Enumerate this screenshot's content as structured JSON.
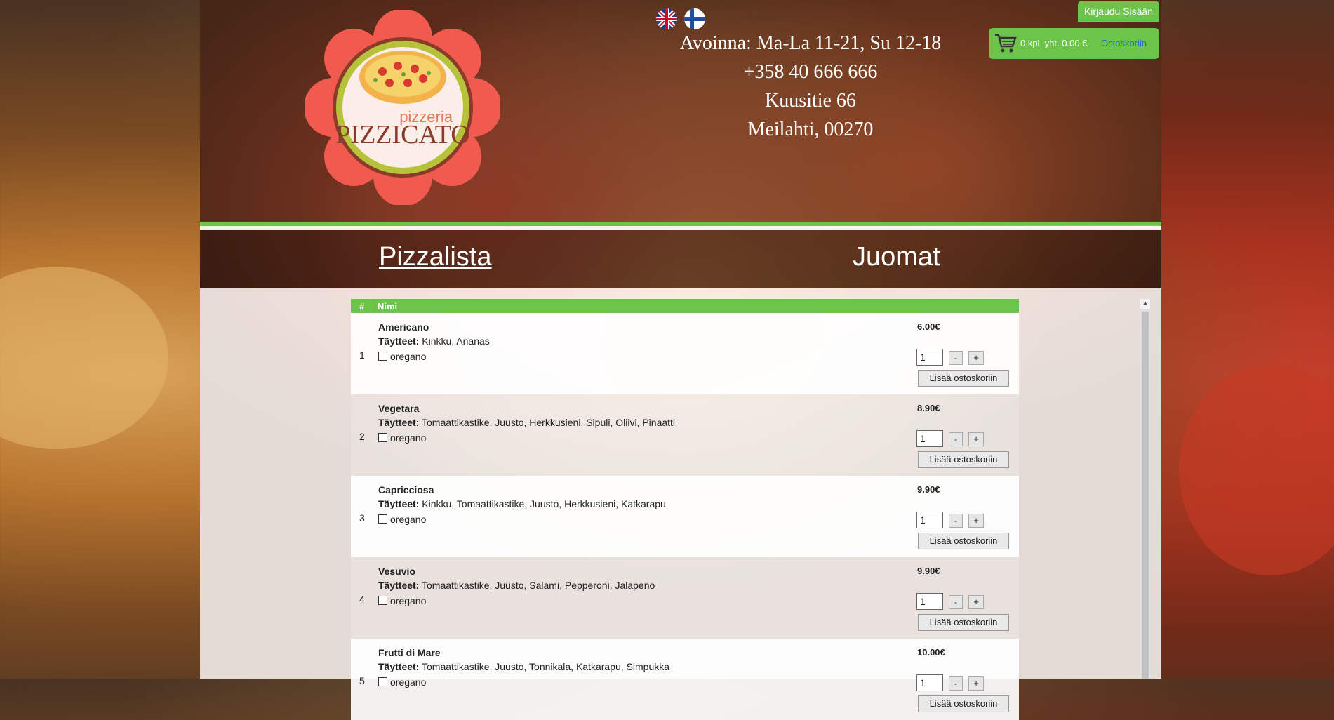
{
  "header": {
    "hours": "Avoinna: Ma-La 11-21, Su 12-18",
    "phone": "+358 40 666 666",
    "street": "Kuusitie 66",
    "city": "Meilahti, 00270",
    "logo_top": "pizzeria",
    "logo_main": "PIZZICATO"
  },
  "flags": [
    "flag-uk-icon",
    "flag-fi-icon"
  ],
  "login": {
    "label": "Kirjaudu Sisään"
  },
  "cart": {
    "summary": "0 kpl, yht. 0.00 €",
    "link": "Ostoskoriin"
  },
  "nav": {
    "pizzas": "Pizzalista",
    "drinks": "Juomat"
  },
  "table": {
    "col_num": "#",
    "col_name": "Nimi",
    "fill_label": "Täytteet:",
    "option_label": "oregano",
    "add_label": "Lisää ostoskoriin",
    "minus_label": "-",
    "plus_label": "+",
    "rows": [
      {
        "num": "1",
        "name": "Americano",
        "fillings": "Kinkku, Ananas",
        "price": "6.00€",
        "qty": "1"
      },
      {
        "num": "2",
        "name": "Vegetara",
        "fillings": "Tomaattikastike, Juusto, Herkkusieni, Sipuli, Oliivi, Pinaatti",
        "price": "8.90€",
        "qty": "1"
      },
      {
        "num": "3",
        "name": "Capricciosa",
        "fillings": "Kinkku, Tomaattikastike, Juusto, Herkkusieni, Katkarapu",
        "price": "9.90€",
        "qty": "1"
      },
      {
        "num": "4",
        "name": "Vesuvio",
        "fillings": "Tomaattikastike, Juusto, Salami, Pepperoni, Jalapeno",
        "price": "9.90€",
        "qty": "1"
      },
      {
        "num": "5",
        "name": "Frutti di Mare",
        "fillings": "Tomaattikastike, Juusto, Tonnikala, Katkarapu, Simpukka",
        "price": "10.00€",
        "qty": "1"
      }
    ]
  },
  "colors": {
    "accent": "#6cc44a",
    "link": "#1d6bd1",
    "logo_petal": "#f15a4f"
  }
}
